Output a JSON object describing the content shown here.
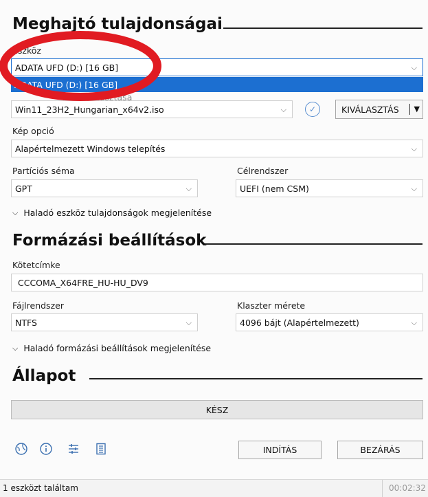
{
  "device_props": {
    "title": "Meghajtó tulajdonságai",
    "device_label": "Eszköz",
    "device_value": "ADATA UFD (D:) [16 GB]",
    "device_dropdown_option": "ADATA UFD (D:) [16 GB]",
    "boot_label_fragment": "(...) kiválasztása",
    "boot_value": "Win11_23H2_Hungarian_x64v2.iso",
    "select_button": "KIVÁLASZTÁS",
    "image_option_label": "Kép opció",
    "image_option_value": "Alapértelmezett Windows telepítés",
    "partition_label": "Partíciós séma",
    "partition_value": "GPT",
    "target_label": "Célrendszer",
    "target_value": "UEFI (nem CSM)",
    "advanced_device": "Haladó eszköz tulajdonságok megjelenítése"
  },
  "format": {
    "title": "Formázási beállítások",
    "volume_label": "Kötetcímke",
    "volume_value": "CCCOMA_X64FRE_HU-HU_DV9",
    "fs_label": "Fájlrendszer",
    "fs_value": "NTFS",
    "cluster_label": "Klaszter mérete",
    "cluster_value": "4096 bájt (Alapértelmezett)",
    "advanced_format": "Haladó formázási beállítások megjelenítése"
  },
  "status": {
    "title": "Állapot",
    "progress_text": "KÉSZ",
    "progress_fraction": 0
  },
  "actions": {
    "start": "INDÍTÁS",
    "close": "BEZÁRÁS"
  },
  "statusbar": {
    "message": "1 eszközt találtam",
    "timer": "00:02:32"
  },
  "icons": [
    "globe-icon",
    "info-icon",
    "settings-sliders-icon",
    "log-icon"
  ],
  "colors": {
    "highlight": "#1c6fd1",
    "annotation": "#e11b22",
    "accent": "#3a6fb0"
  }
}
